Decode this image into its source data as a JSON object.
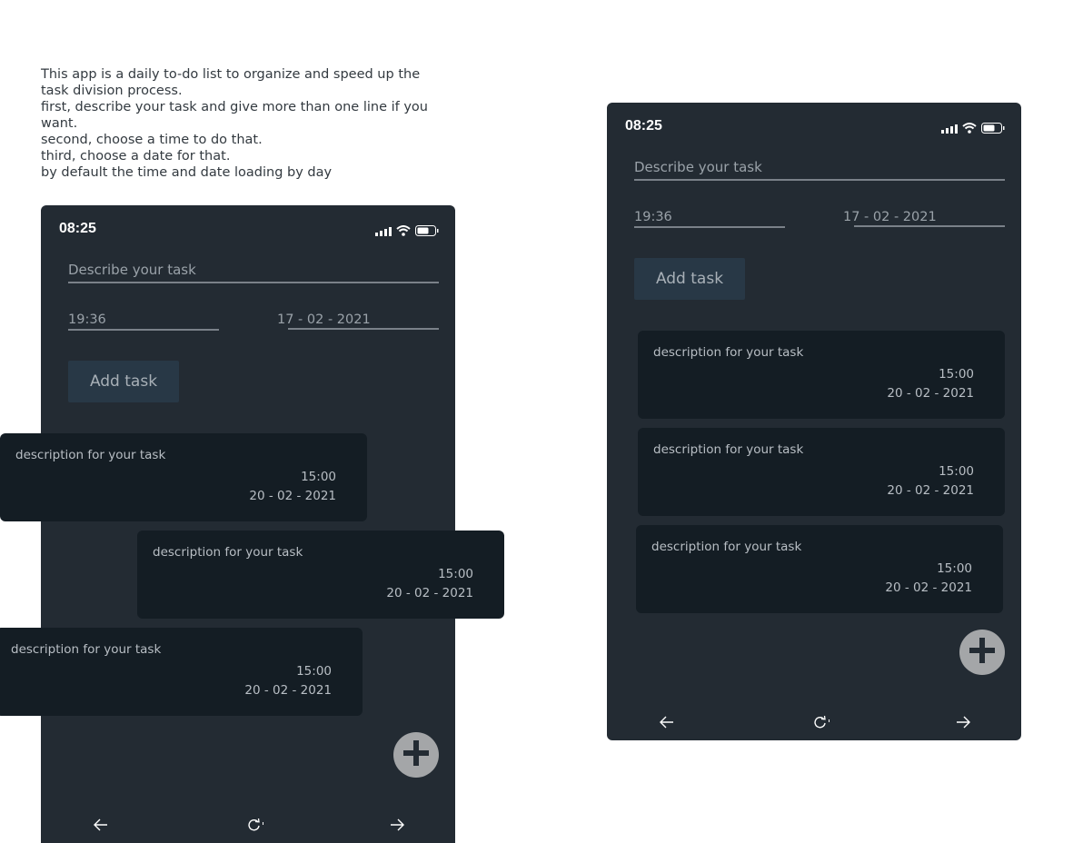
{
  "intro": {
    "lines": [
      "This app is a daily to-do list to organize and speed up the task division process.",
      "first, describe your task and give more than one line if you want.",
      "second, choose a time to do that.",
      "third, choose a date for that.",
      "by default the time and date loading by day"
    ]
  },
  "phones": [
    {
      "status_time": "08:25",
      "task_placeholder": "Describe your task",
      "time_value": "19:36",
      "date_value": "17 - 02 - 2021",
      "add_label": "Add task",
      "tasks": [
        {
          "desc": "description for your task",
          "time": "15:00",
          "date": "20 - 02 - 2021"
        },
        {
          "desc": "description for your task",
          "time": "15:00",
          "date": "20 - 02 - 2021"
        },
        {
          "desc": "description for your task",
          "time": "15:00",
          "date": "20 - 02 - 2021"
        }
      ]
    },
    {
      "status_time": "08:25",
      "task_placeholder": "Describe your task",
      "time_value": "19:36",
      "date_value": "17 - 02 - 2021",
      "add_label": "Add task",
      "tasks": [
        {
          "desc": "description for your task",
          "time": "15:00",
          "date": "20 - 02 - 2021"
        },
        {
          "desc": "description for your task",
          "time": "15:00",
          "date": "20 - 02 - 2021"
        },
        {
          "desc": "description for your task",
          "time": "15:00",
          "date": "20 - 02 - 2021"
        }
      ]
    }
  ],
  "icons": {
    "signal": "signal-icon",
    "wifi": "wifi-icon",
    "battery": "battery-icon",
    "fab": "plus-icon",
    "back": "arrow-left-icon",
    "reload": "reload-icon",
    "forward": "arrow-right-icon"
  },
  "colors": {
    "phone_bg": "#232b33",
    "card_bg": "#141d24",
    "button_bg": "#283846",
    "fab_bg": "#a4a6a8"
  }
}
